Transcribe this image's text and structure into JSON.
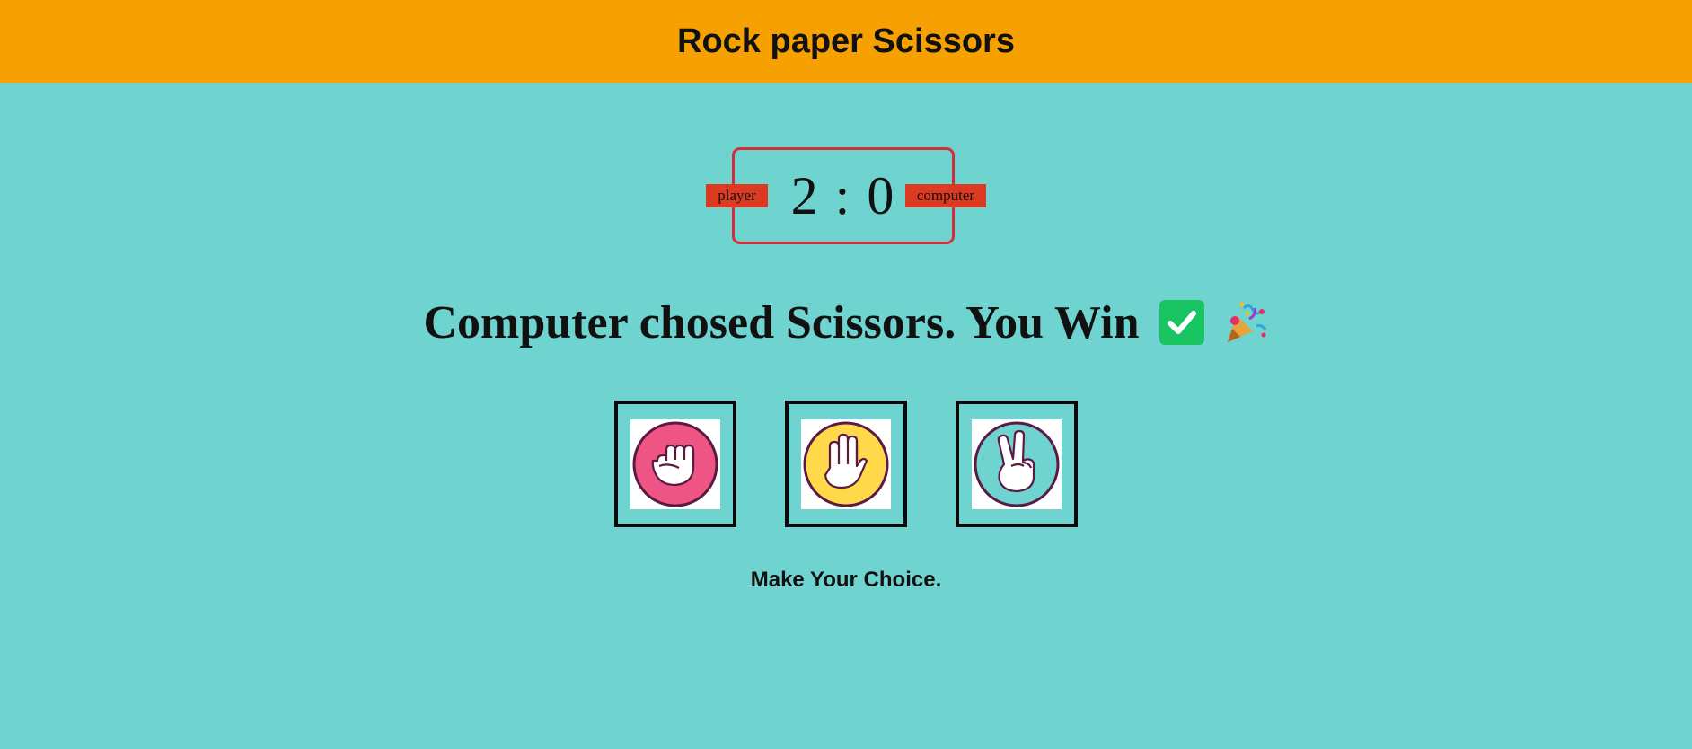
{
  "header": {
    "title": "Rock paper Scissors"
  },
  "score": {
    "display": "2 : 0",
    "player": 2,
    "computer": 0,
    "player_label": "player",
    "computer_label": "computer"
  },
  "result": {
    "message": "Computer chosed Scissors. You Win",
    "icons": [
      "check-mark-icon",
      "party-popper-icon"
    ]
  },
  "choices": [
    {
      "name": "rock",
      "icon": "rock-fist-icon",
      "color": "#ee5584"
    },
    {
      "name": "paper",
      "icon": "paper-hand-icon",
      "color": "#ffd94a"
    },
    {
      "name": "scissors",
      "icon": "scissors-hand-icon",
      "color": "#6fd3cf"
    }
  ],
  "prompt": "Make Your Choice.",
  "colors": {
    "header_bg": "#f6a101",
    "page_bg": "#6fd3cf",
    "score_border": "#d1303a",
    "badge_bg": "#dd3a22",
    "check_bg": "#18c562"
  }
}
